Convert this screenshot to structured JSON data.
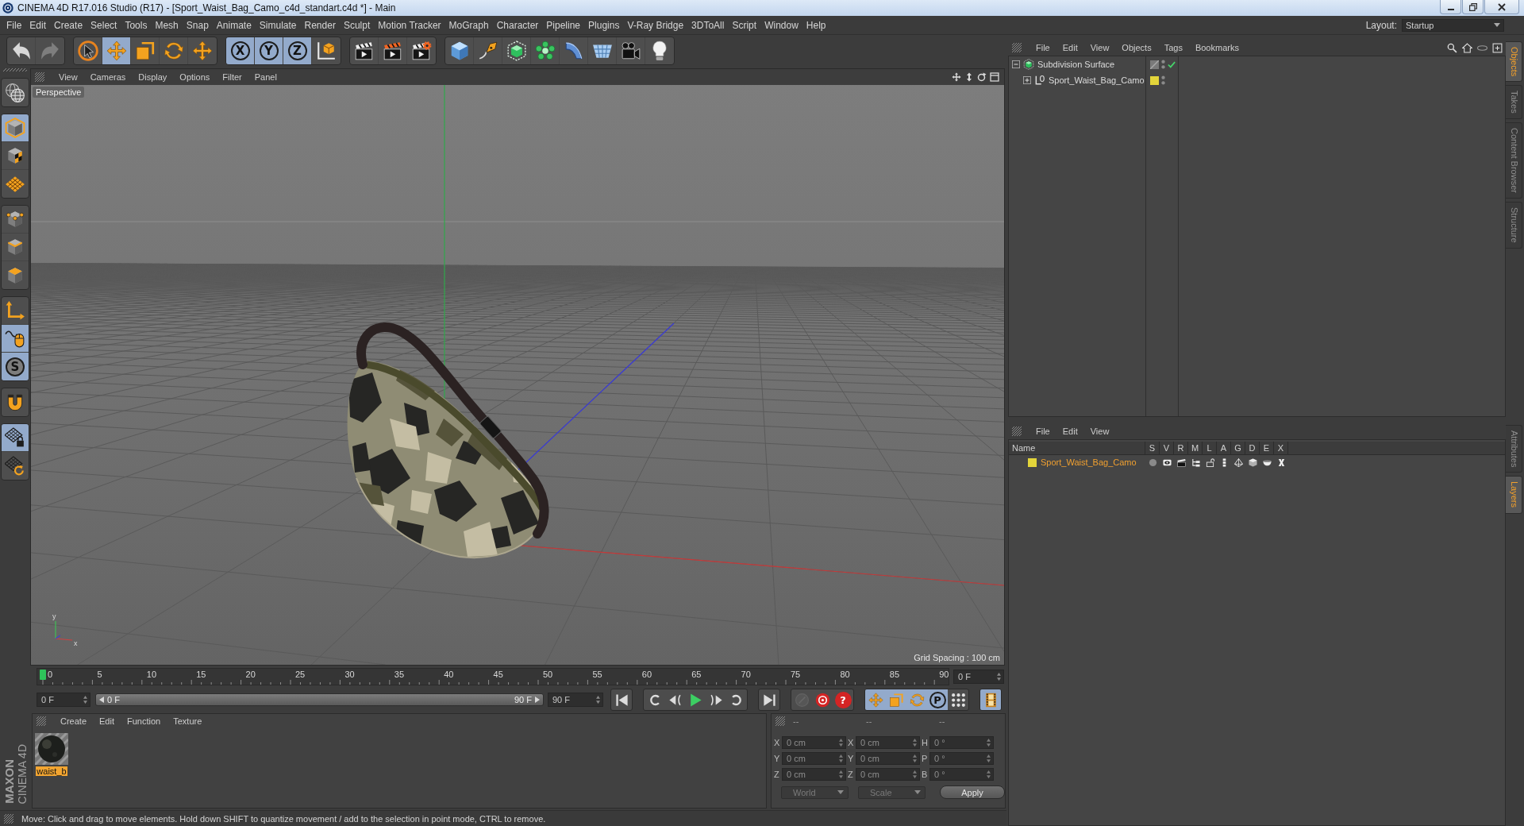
{
  "window": {
    "title": "CINEMA 4D R17.016 Studio (R17) - [Sport_Waist_Bag_Camo_c4d_standart.c4d *] - Main"
  },
  "menu_bar": {
    "items": [
      "File",
      "Edit",
      "Create",
      "Select",
      "Tools",
      "Mesh",
      "Snap",
      "Animate",
      "Simulate",
      "Render",
      "Sculpt",
      "Motion Tracker",
      "MoGraph",
      "Character",
      "Pipeline",
      "Plugins",
      "V-Ray Bridge",
      "3DToAll",
      "Script",
      "Window",
      "Help"
    ],
    "layout_label": "Layout:",
    "layout_value": "Startup"
  },
  "toolbar": {
    "groups": [
      {
        "items": [
          {
            "kind": "undo",
            "disabled": false
          },
          {
            "kind": "redo",
            "disabled": true
          }
        ]
      },
      {
        "items": [
          {
            "kind": "live-select",
            "selected": false
          },
          {
            "kind": "move",
            "selected": true
          },
          {
            "kind": "scale",
            "selected": false
          },
          {
            "kind": "rotate",
            "selected": false
          },
          {
            "kind": "recent-tool",
            "selected": false
          }
        ]
      },
      {
        "items": [
          {
            "kind": "axis-lock",
            "label": "X",
            "selected": true
          },
          {
            "kind": "axis-lock",
            "label": "Y",
            "selected": true
          },
          {
            "kind": "axis-lock",
            "label": "Z",
            "selected": true
          },
          {
            "kind": "coordinate-system",
            "selected": false
          }
        ]
      },
      {
        "items": [
          {
            "kind": "render-view",
            "selected": false
          },
          {
            "kind": "render-picture",
            "selected": false
          },
          {
            "kind": "render-settings",
            "selected": false
          }
        ]
      },
      {
        "items": [
          {
            "kind": "cube",
            "selected": false
          },
          {
            "kind": "pen",
            "selected": false
          },
          {
            "kind": "subdivision",
            "selected": false
          },
          {
            "kind": "cloner",
            "selected": false
          },
          {
            "kind": "bend",
            "selected": false
          },
          {
            "kind": "floor",
            "selected": false
          },
          {
            "kind": "camera",
            "selected": false
          },
          {
            "kind": "light",
            "selected": false
          }
        ]
      }
    ]
  },
  "left_toolbar": {
    "groups": [
      {
        "items": [
          {
            "kind": "make-editable",
            "selected": false
          }
        ]
      },
      {
        "items": [
          {
            "kind": "model",
            "selected": true
          },
          {
            "kind": "texture",
            "selected": false
          },
          {
            "kind": "workplane",
            "selected": false
          }
        ]
      },
      {
        "items": [
          {
            "kind": "points",
            "selected": false
          },
          {
            "kind": "edges",
            "selected": false
          },
          {
            "kind": "polygons",
            "selected": false
          }
        ]
      },
      {
        "items": [
          {
            "kind": "axis",
            "selected": false
          },
          {
            "kind": "tweak",
            "selected": true
          },
          {
            "kind": "snap",
            "label": "S",
            "selected": true
          }
        ]
      },
      {
        "items": [
          {
            "kind": "magnet",
            "selected": false
          }
        ]
      },
      {
        "items": [
          {
            "kind": "workplane-lock",
            "selected": true
          },
          {
            "kind": "workplane-align",
            "selected": false
          }
        ]
      }
    ],
    "logo": [
      "MAXON",
      "CINEMA 4D"
    ]
  },
  "viewport": {
    "menu": [
      "View",
      "Cameras",
      "Display",
      "Options",
      "Filter",
      "Panel"
    ],
    "camera_label": "Perspective",
    "grid_spacing": "Grid Spacing : 100 cm",
    "gizmo_labels": [
      "y",
      "x"
    ]
  },
  "timeline": {
    "ticks": [
      "0",
      "5",
      "10",
      "15",
      "20",
      "25",
      "30",
      "35",
      "40",
      "45",
      "50",
      "55",
      "60",
      "65",
      "70",
      "75",
      "80",
      "85",
      "90"
    ],
    "playhead": {
      "level": 0
    },
    "current_frame": "0 F"
  },
  "playback": {
    "start_field": "0 F",
    "range": {
      "start": "0 F",
      "end": "90 F",
      "handles": [
        {
          "level": 0
        },
        {
          "level": 1
        }
      ]
    },
    "end_field": "90 F",
    "groups": [
      {
        "items": [
          {
            "kind": "go-start"
          }
        ]
      },
      {
        "items": [
          {
            "kind": "prev-key"
          },
          {
            "kind": "prev-frame"
          },
          {
            "kind": "play"
          },
          {
            "kind": "next-frame"
          },
          {
            "kind": "next-key"
          }
        ]
      },
      {
        "items": [
          {
            "kind": "go-end"
          }
        ]
      },
      {
        "items": [
          {
            "kind": "record-objects",
            "disabled": true
          },
          {
            "kind": "autokey",
            "disabled": false
          },
          {
            "kind": "key-selection",
            "label": "?",
            "disabled": false
          }
        ]
      },
      {
        "items": [
          {
            "kind": "key-position",
            "selected": true
          },
          {
            "kind": "key-scale",
            "selected": true
          },
          {
            "kind": "key-rotation",
            "selected": true
          },
          {
            "kind": "key-parameter",
            "label": "P",
            "selected": true
          },
          {
            "kind": "key-point-level",
            "selected": false
          }
        ]
      },
      {
        "items": [
          {
            "kind": "timeline",
            "selected": true
          }
        ]
      }
    ]
  },
  "materials": {
    "menu": [
      "Create",
      "Edit",
      "Function",
      "Texture"
    ],
    "items": [
      {
        "name": "waist_b",
        "selected": true
      }
    ]
  },
  "coordinates": {
    "headers": [
      "--",
      "--",
      "--"
    ],
    "rows": [
      {
        "fields": [
          {
            "axis": "X",
            "value": "0 cm"
          },
          {
            "axis": "X",
            "value": "0 cm"
          },
          {
            "axis": "H",
            "value": "0 °"
          }
        ]
      },
      {
        "fields": [
          {
            "axis": "Y",
            "value": "0 cm"
          },
          {
            "axis": "Y",
            "value": "0 cm"
          },
          {
            "axis": "P",
            "value": "0 °"
          }
        ]
      },
      {
        "fields": [
          {
            "axis": "Z",
            "value": "0 cm"
          },
          {
            "axis": "Z",
            "value": "0 cm"
          },
          {
            "axis": "B",
            "value": "0 °"
          }
        ]
      }
    ],
    "dropdowns": [
      {
        "value": "World",
        "disabled": true
      },
      {
        "value": "Scale",
        "disabled": true
      }
    ],
    "apply": "Apply"
  },
  "status_bar": {
    "text": "Move: Click and drag to move elements. Hold down SHIFT to quantize movement / add to the selection in point mode, CTRL to remove."
  },
  "object_manager": {
    "menu": [
      "File",
      "Edit",
      "View",
      "Objects",
      "Tags",
      "Bookmarks"
    ],
    "objects": [
      {
        "name": "Subdivision Surface",
        "kind": "subdivision",
        "expanded": true,
        "enabled": true,
        "children": [
          {
            "name": "Sport_Waist_Bag_Camo",
            "kind": "null",
            "expanded": false,
            "color": "#e2d43a"
          }
        ]
      }
    ]
  },
  "layer_manager": {
    "menu": [
      "File",
      "Edit",
      "View"
    ],
    "columns": [
      "Name",
      "S",
      "V",
      "R",
      "M",
      "L",
      "A",
      "G",
      "D",
      "E",
      "X"
    ],
    "layers": [
      {
        "name": "Sport_Waist_Bag_Camo",
        "color": "#e2d43a",
        "selected": true,
        "flags": [
          {
            "kind": "solo",
            "on": false
          },
          {
            "kind": "view",
            "on": true
          },
          {
            "kind": "render",
            "on": true
          },
          {
            "kind": "manager",
            "on": true
          },
          {
            "kind": "lock",
            "on": false
          },
          {
            "kind": "animation",
            "on": true
          },
          {
            "kind": "generators",
            "on": true
          },
          {
            "kind": "deformers",
            "on": true
          },
          {
            "kind": "expressions",
            "on": true
          },
          {
            "kind": "xref",
            "on": true
          }
        ]
      }
    ]
  },
  "side_tabs": {
    "top": [
      {
        "label": "Objects",
        "selected": true
      },
      {
        "label": "Takes",
        "selected": false
      },
      {
        "label": "Content Browser",
        "selected": false
      },
      {
        "label": "Structure",
        "selected": false
      }
    ],
    "bottom": [
      {
        "label": "Attributes",
        "selected": false
      },
      {
        "label": "Layers",
        "selected": true
      }
    ]
  }
}
